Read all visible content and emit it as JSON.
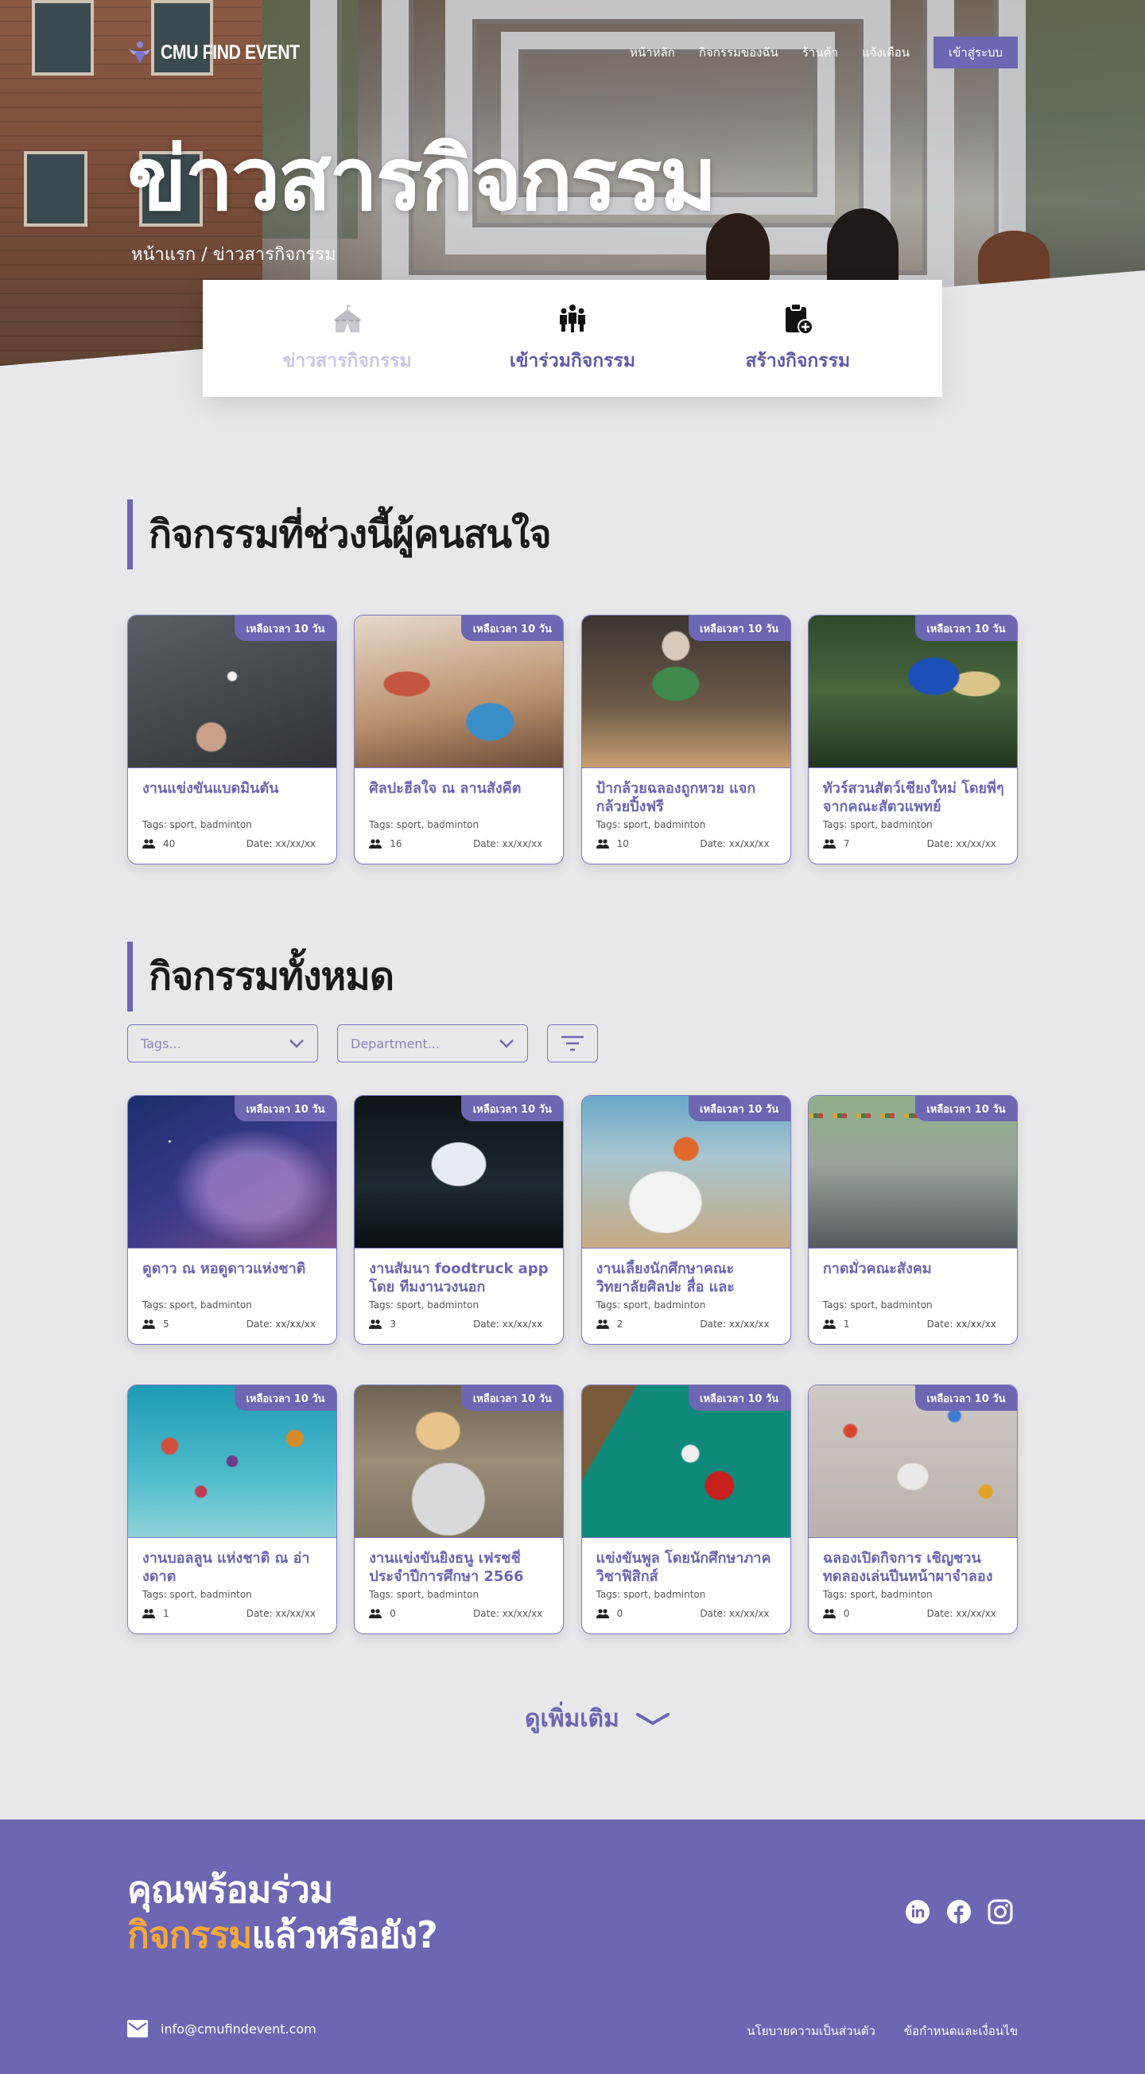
{
  "brand": {
    "name": "CMU FIND EVENT",
    "accent": "#6c66b3",
    "highlight": "#f4a83a"
  },
  "nav": {
    "items": [
      "หน้าหลัก",
      "กิจกรรมของฉัน",
      "ร้านค้า",
      "แจ้งเตือน"
    ],
    "login_label": "เข้าสู่ระบบ"
  },
  "hero": {
    "title": "ข่าวสารกิจกรรม",
    "breadcrumb": "หน้าแรก / ข่าวสารกิจกรรม"
  },
  "hero_tabs": [
    {
      "label": "ข่าวสารกิจกรรม",
      "icon": "circus-tent-icon"
    },
    {
      "label": "เข้าร่วมกิจกรรม",
      "icon": "group-icon"
    },
    {
      "label": "สร้างกิจกรรม",
      "icon": "clipboard-add-icon"
    }
  ],
  "popular": {
    "title": "กิจกรรมที่ช่วงนี้ผู้คนสนใจ",
    "cards": [
      {
        "badge": "เหลือเวลา 10 วัน",
        "title": "งานแข่งขันแบดมินตัน",
        "tags": "Tags: sport, badminton",
        "count": "40",
        "date": "Date: xx/xx/xx"
      },
      {
        "badge": "เหลือเวลา 10 วัน",
        "title": "ศิลปะฮีลใจ ณ ลานสังคีต",
        "tags": "Tags: sport, badminton",
        "count": "16",
        "date": "Date: xx/xx/xx"
      },
      {
        "badge": "เหลือเวลา 10 วัน",
        "title": "ป้ากล้วยฉลองถูกหวย แจกกล้วยปิ้งฟรี",
        "tags": "Tags: sport, badminton",
        "count": "10",
        "date": "Date: xx/xx/xx"
      },
      {
        "badge": "เหลือเวลา 10 วัน",
        "title": "ทัวร์สวนสัตว์เชียงใหม่ โดยพี่ๆจากคณะสัตวแพทย์มหาวิทยาลัย",
        "tags": "Tags: sport, badminton",
        "count": "7",
        "date": "Date: xx/xx/xx"
      }
    ]
  },
  "all": {
    "title": "กิจกรรมทั้งหมด",
    "filters": {
      "tags_placeholder": "Tags...",
      "department_placeholder": "Department..."
    },
    "cards": [
      {
        "badge": "เหลือเวลา 10 วัน",
        "title": "ดูดาว ณ หอดูดาวแห่งชาติ",
        "tags": "Tags: sport, badminton",
        "count": "5",
        "date": "Date: xx/xx/xx"
      },
      {
        "badge": "เหลือเวลา 10 วัน",
        "title": "งานสัมนา foodtruck app โดย ทีมงานวงนอก",
        "tags": "Tags: sport, badminton",
        "count": "3",
        "date": "Date: xx/xx/xx"
      },
      {
        "badge": "เหลือเวลา 10 วัน",
        "title": "งานเลี้ยงนักศึกษาคณะวิทยาลัยศิลปะ สื่อ และเทคโนโลยีดิจิทัล",
        "tags": "Tags: sport, badminton",
        "count": "2",
        "date": "Date: xx/xx/xx"
      },
      {
        "badge": "เหลือเวลา 10 วัน",
        "title": "กาดมั่วคณะสังคม",
        "tags": "Tags: sport, badminton",
        "count": "1",
        "date": "Date: xx/xx/xx"
      },
      {
        "badge": "เหลือเวลา 10 วัน",
        "title": "งานบอลลูน แห่งชาติ ณ อ่างดาต",
        "tags": "Tags: sport, badminton",
        "count": "1",
        "date": "Date: xx/xx/xx"
      },
      {
        "badge": "เหลือเวลา 10 วัน",
        "title": "งานแข่งขันยิงธนู เฟรชชี่ ประจำปีการศึกษา 2566",
        "tags": "Tags: sport, badminton",
        "count": "0",
        "date": "Date: xx/xx/xx"
      },
      {
        "badge": "เหลือเวลา 10 วัน",
        "title": "แข่งขันพูล โดยนักศึกษาภาควิชาฟิสิกส์",
        "tags": "Tags: sport, badminton",
        "count": "0",
        "date": "Date: xx/xx/xx"
      },
      {
        "badge": "เหลือเวลา 10 วัน",
        "title": "ฉลองเปิดกิจการ เชิญชวนทดลองเล่นปีนหน้าผาจำลอง",
        "tags": "Tags: sport, badminton",
        "count": "0",
        "date": "Date: xx/xx/xx"
      }
    ],
    "more_label": "ดูเพิ่มเติม"
  },
  "footer": {
    "cta_line1": "คุณพร้อมร่วม",
    "cta_highlight": "กิจกรรม",
    "cta_line2_rest": "แล้วหรือยัง?",
    "email": "info@cmufindevent.com",
    "privacy": "นโยบายความเป็นส่วนตัว",
    "terms": "ข้อกำหนดและเงื่อนไข",
    "socials": [
      "linkedin-icon",
      "facebook-icon",
      "instagram-icon"
    ]
  }
}
